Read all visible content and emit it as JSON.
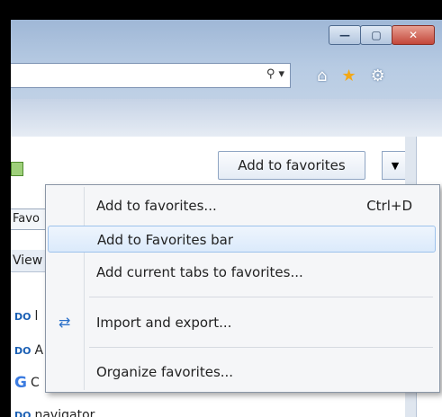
{
  "window": {
    "caption": {
      "minimize": "—",
      "maximize": "▢",
      "close": "✕"
    },
    "address_bar": {
      "search_glyph": "⚲ ▾"
    },
    "nav": {
      "home": "⌂",
      "favorites": "★",
      "tools": "⚙"
    }
  },
  "favorites_center": {
    "add_button_label": "Add to favorites",
    "add_button_arrow": "▼",
    "tab_label": "Favo",
    "view_label": "View",
    "items": [
      {
        "icon": "DO",
        "label": "l"
      },
      {
        "icon": "DO",
        "label": "A"
      },
      {
        "icon": "G",
        "label": "C"
      },
      {
        "icon": "DO",
        "label": "navigator"
      }
    ]
  },
  "menu": {
    "items": [
      {
        "label": "Add to favorites...",
        "shortcut": "Ctrl+D"
      },
      {
        "label": "Add to Favorites bar",
        "shortcut": ""
      },
      {
        "label": "Add current tabs to favorites...",
        "shortcut": ""
      },
      {
        "label": "Import and export...",
        "shortcut": ""
      },
      {
        "label": "Organize favorites...",
        "shortcut": ""
      }
    ],
    "highlighted_index": 1
  },
  "colors": {
    "accent": "#f2a818",
    "highlight_border": "#9dc2ec"
  }
}
